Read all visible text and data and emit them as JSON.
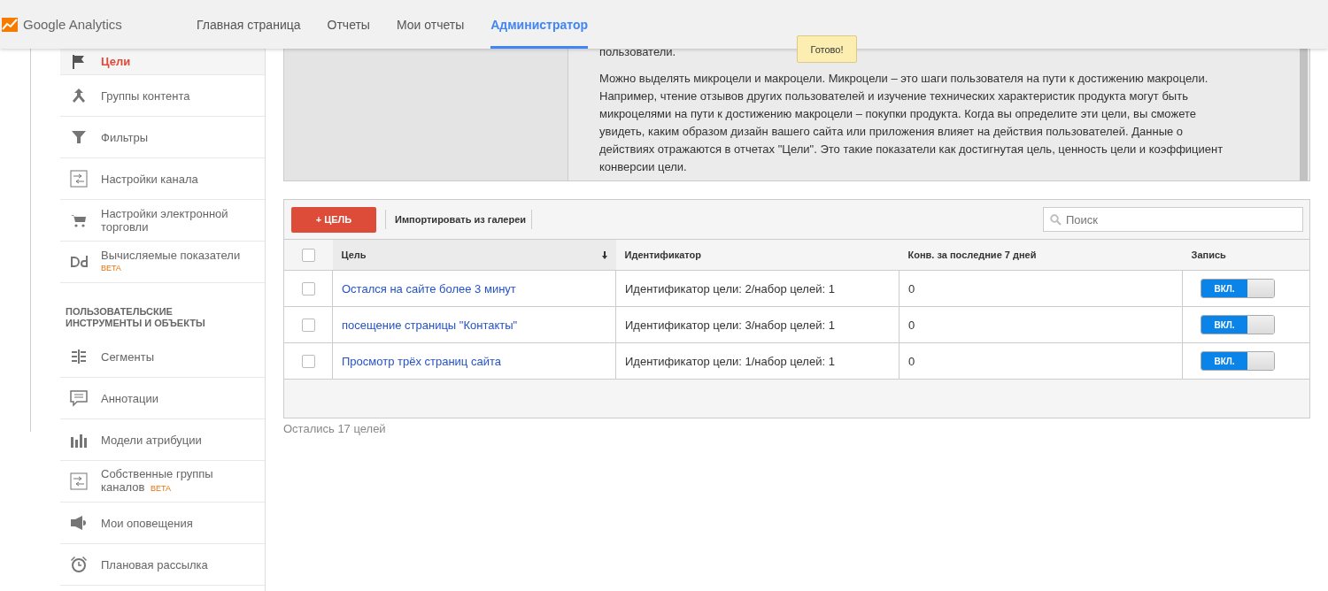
{
  "header": {
    "logo": "Google Analytics",
    "tabs": [
      {
        "label": "Главная страница",
        "selected": false
      },
      {
        "label": "Отчеты",
        "selected": false
      },
      {
        "label": "Мои отчеты",
        "selected": false
      },
      {
        "label": "Администратор",
        "selected": true
      }
    ]
  },
  "tooltip": "Готово!",
  "sidebar": {
    "items": [
      {
        "kind": "item",
        "label": "Цели",
        "selected": true
      },
      {
        "kind": "item",
        "label": "Группы контента",
        "selected": false
      },
      {
        "kind": "item",
        "label": "Фильтры",
        "selected": false
      },
      {
        "kind": "item",
        "label": "Настройки канала",
        "selected": false
      },
      {
        "kind": "item",
        "label": "Настройки электронной торговли",
        "selected": false
      },
      {
        "kind": "item",
        "label": "Вычисляемые показатели",
        "beta": "BETA",
        "beta_newline": true,
        "selected": false
      },
      {
        "kind": "section",
        "label": "ПОЛЬЗОВАТЕЛЬСКИЕ ИНСТРУМЕНТЫ И ОБЪЕКТЫ"
      },
      {
        "kind": "item",
        "label": "Сегменты",
        "selected": false
      },
      {
        "kind": "item",
        "label": "Аннотации",
        "selected": false
      },
      {
        "kind": "item",
        "label": "Модели атрибуции",
        "selected": false
      },
      {
        "kind": "item",
        "label": "Собственные группы каналов",
        "beta": "BETA",
        "beta_newline": false,
        "selected": false
      },
      {
        "kind": "item",
        "label": "Мои оповещения",
        "selected": false
      },
      {
        "kind": "item",
        "label": "Плановая рассылка",
        "selected": false
      }
    ]
  },
  "info": {
    "paragraphs": [
      "пользователи.",
      "Можно выделять микроцели и макроцели. Микроцели – это шаги пользователя на пути к достижению макроцели. Например, чтение отзывов других пользователей и изучение технических характеристик продукта могут быть микроцелями на пути к достижению макроцели – покупки продукта. Когда вы определите эти цели, вы сможете увидеть, каким образом дизайн вашего сайта или приложения влияет на действия пользователей. Данные о действиях отражаются в отчетах \"Цели\". Это такие показатели как достигнутая цель, ценность цели и коэффициент конверсии цели."
    ]
  },
  "toolbar": {
    "add_button": "+ ЦЕЛЬ",
    "import_link": "Импортировать из галереи",
    "search": {
      "placeholder": "Поиск"
    }
  },
  "table": {
    "select_all": {
      "checked": false
    },
    "columns": [
      "Цель",
      "Идентификатор",
      "Конв. за последние 7 дней",
      "Запись"
    ],
    "rows": [
      {
        "checked": false,
        "goal": "Остался на сайте более 3 минут",
        "id": "Идентификатор цели: 2/набор целей: 1",
        "conversions": "0",
        "recording": {
          "label": "ВКЛ.",
          "on": true
        }
      },
      {
        "checked": false,
        "goal": "посещение страницы \"Контакты\"",
        "id": "Идентификатор цели: 3/набор целей: 1",
        "conversions": "0",
        "recording": {
          "label": "ВКЛ.",
          "on": true
        }
      },
      {
        "checked": false,
        "goal": "Просмотр трёх страниц сайта",
        "id": "Идентификатор цели: 1/набор целей: 1",
        "conversions": "0",
        "recording": {
          "label": "ВКЛ.",
          "on": true
        }
      }
    ]
  },
  "footer": "Остались 17 целей"
}
